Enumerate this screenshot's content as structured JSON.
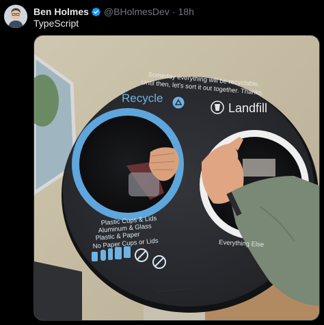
{
  "author": {
    "display_name": "Ben Holmes",
    "handle": "@BHolmesDev",
    "separator": "·",
    "timestamp": "18h",
    "verified": true,
    "avatar_icon": "person-avatar"
  },
  "tweet": {
    "text": "TypeScript"
  },
  "media": {
    "alt": "Recycling bin lid with Recycle and Landfill openings",
    "lid_text": {
      "line1": "Someday everything will be recyclable.",
      "line2": "Until then, let's sort it out together. Thanks.",
      "recycle_label": "Recycle",
      "landfill_label": "Landfill",
      "recycle_items": [
        "Plastic Cups & Lids",
        "Aluminum & Glass",
        "Plastic & Paper",
        "No Paper Cups or Lids"
      ],
      "landfill_caption": "Everything Else"
    }
  },
  "colors": {
    "background": "#000000",
    "text_primary": "#e7e9ea",
    "text_secondary": "#71767b",
    "verified_blue": "#1d9bf0",
    "lid": "#2b2d31",
    "recycle_blue": "#5ea6db",
    "landfill_white": "#f2f2f2"
  }
}
